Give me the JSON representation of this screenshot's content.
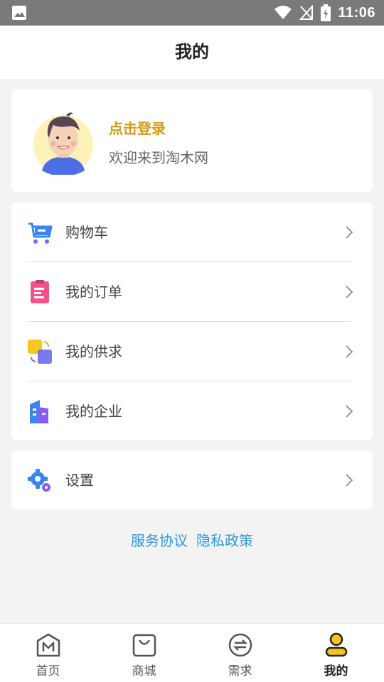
{
  "status_bar": {
    "time": "11:06",
    "icons": [
      "image-icon",
      "wifi-icon",
      "no-signal-icon",
      "battery-charging-icon"
    ]
  },
  "header": {
    "title": "我的"
  },
  "profile": {
    "login_label": "点击登录",
    "welcome_text": "欢迎来到淘木网",
    "avatar_icon": "user-avatar-icon"
  },
  "menu": {
    "items": [
      {
        "label": "购物车",
        "icon": "shopping-cart-icon"
      },
      {
        "label": "我的订单",
        "icon": "order-clipboard-icon"
      },
      {
        "label": "我的供求",
        "icon": "supply-demand-icon"
      },
      {
        "label": "我的企业",
        "icon": "enterprise-building-icon"
      }
    ]
  },
  "settings": {
    "label": "设置",
    "icon": "settings-gear-icon"
  },
  "links": {
    "service_agreement": "服务协议",
    "privacy_policy": "隐私政策"
  },
  "tab_bar": {
    "tabs": [
      {
        "label": "首页",
        "icon": "home-m-icon",
        "active": false
      },
      {
        "label": "商城",
        "icon": "shopping-bag-icon",
        "active": false
      },
      {
        "label": "需求",
        "icon": "exchange-icon",
        "active": false
      },
      {
        "label": "我的",
        "icon": "profile-person-icon",
        "active": true
      }
    ]
  },
  "colors": {
    "status_bar": "#7a7a7a",
    "login_accent": "#d49a1a",
    "link": "#2f9be0",
    "background": "#f3f3f3",
    "active_tab_icon": "#f5c518"
  }
}
